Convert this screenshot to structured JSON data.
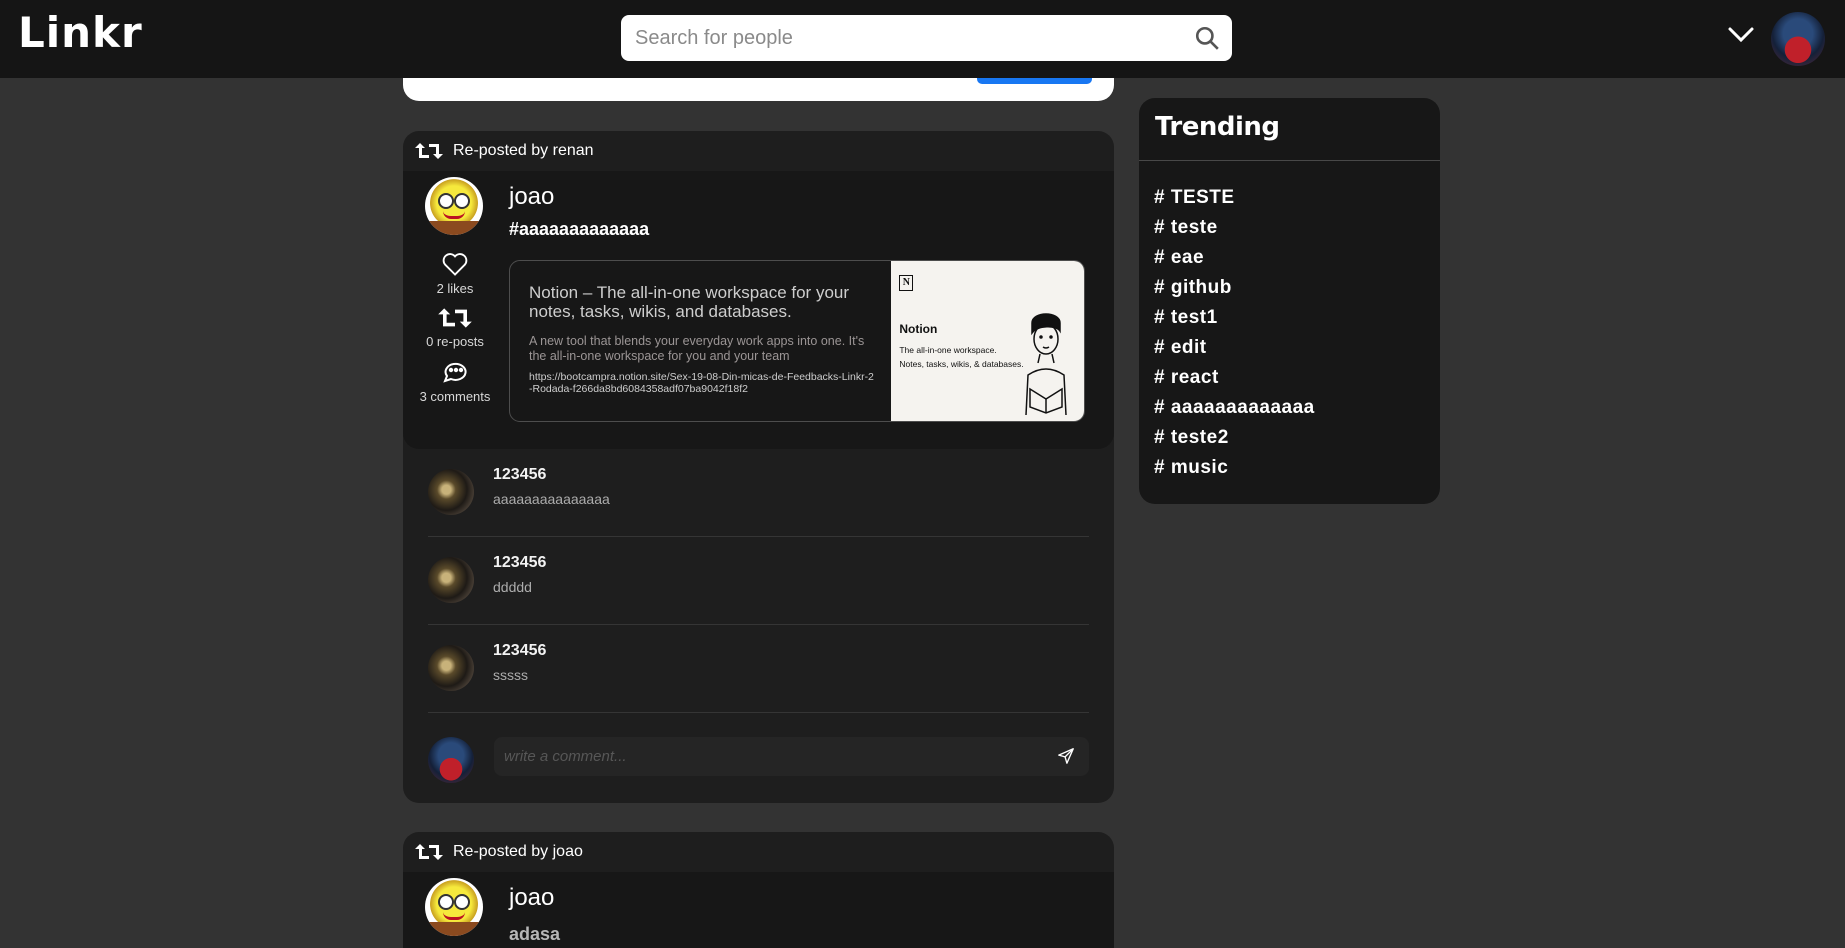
{
  "header": {
    "logo": "Linkr",
    "search_placeholder": "Search for people"
  },
  "posts": [
    {
      "repost_label": "Re-posted by renan",
      "username": "joao",
      "text": "#aaaaaaaaaaaaa",
      "likes_label": "2 likes",
      "reposts_label": "0 re-posts",
      "comments_label": "3 comments",
      "link": {
        "title": "Notion – The all-in-one workspace for your notes, tasks, wikis, and databases.",
        "description": "A new tool that blends your everyday work apps into one. It's the all-in-one workspace for you and your team",
        "url": "https://bootcampra.notion.site/Sex-19-08-Din-micas-de-Feedbacks-Linkr-2-Rodada-f266da8bd6084358adf07ba9042f18f2",
        "image_title": "Notion",
        "image_line1": "The all-in-one workspace.",
        "image_line2": "Notes, tasks, wikis, & databases."
      },
      "comments": [
        {
          "name": "123456",
          "text": "aaaaaaaaaaaaaaa"
        },
        {
          "name": "123456",
          "text": "ddddd"
        },
        {
          "name": "123456",
          "text": "sssss"
        }
      ],
      "comment_placeholder": "write a comment..."
    },
    {
      "repost_label": "Re-posted by joao",
      "username": "joao",
      "text": "adasa"
    }
  ],
  "trending": {
    "title": "Trending",
    "tags": [
      "# TESTE",
      "# teste",
      "# eae",
      "# github",
      "# test1",
      "# edit",
      "# react",
      "# aaaaaaaaaaaaa",
      "# teste2",
      "# music"
    ]
  },
  "colors": {
    "background": "#333333",
    "header": "#151515",
    "card": "#171717",
    "accent": "#1877f2"
  }
}
